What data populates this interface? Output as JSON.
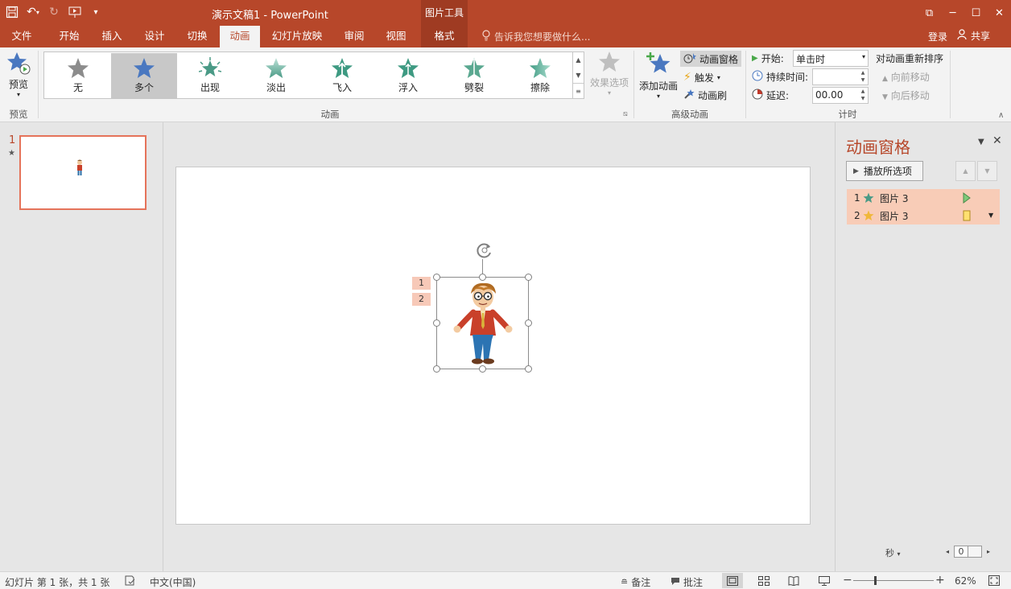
{
  "titlebar": {
    "title": "演示文稿1 - PowerPoint",
    "context_tab": "图片工具"
  },
  "tabs": [
    "文件",
    "开始",
    "插入",
    "设计",
    "切换",
    "动画",
    "幻灯片放映",
    "审阅",
    "视图",
    "格式"
  ],
  "active_tab": "动画",
  "tell_me": "告诉我您想要做什么...",
  "signin": "登录",
  "share": "共享",
  "ribbon": {
    "preview": {
      "label": "预览",
      "group": "预览"
    },
    "animation_group": "动画",
    "gallery": [
      {
        "label": "无",
        "color": "#8c8c8c",
        "shape": "star"
      },
      {
        "label": "多个",
        "color": "#4a78c0",
        "shape": "star"
      },
      {
        "label": "出现",
        "color": "#4a9a86",
        "shape": "burst"
      },
      {
        "label": "淡出",
        "color": "#7cc0ae",
        "shape": "star"
      },
      {
        "label": "飞入",
        "color": "#3e9a82",
        "shape": "star"
      },
      {
        "label": "浮入",
        "color": "#3e9a82",
        "shape": "star"
      },
      {
        "label": "劈裂",
        "color": "#5aa890",
        "shape": "star"
      },
      {
        "label": "擦除",
        "color": "#5aa890",
        "shape": "star"
      }
    ],
    "selected_gallery": "多个",
    "effect_options": "效果选项",
    "advanced": {
      "group": "高级动画",
      "add_animation": "添加动画",
      "animation_pane": "动画窗格",
      "trigger": "触发",
      "painter": "动画刷"
    },
    "timing": {
      "group": "计时",
      "start_label": "开始:",
      "start_value": "单击时",
      "duration_label": "持续时间:",
      "duration_value": "",
      "delay_label": "延迟:",
      "delay_value": "00.00",
      "reorder_label": "对动画重新排序",
      "move_earlier": "向前移动",
      "move_later": "向后移动"
    }
  },
  "thumbnails": [
    {
      "number": "1",
      "marker": "★"
    }
  ],
  "slide": {
    "animation_tags": [
      "1",
      "2"
    ]
  },
  "animation_pane": {
    "title": "动画窗格",
    "play_selected": "播放所选项",
    "items": [
      {
        "index": "1",
        "name": "图片 3",
        "effect_color": "#4a9a86",
        "timeline_color": "#7fca7a"
      },
      {
        "index": "2",
        "name": "图片 3",
        "effect_color": "#f0b73a",
        "timeline_color": "#ffe070"
      }
    ],
    "seconds_label": "秒",
    "timeline_value": "0"
  },
  "statusbar": {
    "slide_info": "幻灯片 第 1 张，共 1 张",
    "language": "中文(中国)",
    "notes": "备注",
    "comments": "批注",
    "zoom": "62%"
  },
  "colors": {
    "brand": "#b7472a",
    "brand_dark": "#9f3b22",
    "selected_item": "#f8ccb7"
  }
}
